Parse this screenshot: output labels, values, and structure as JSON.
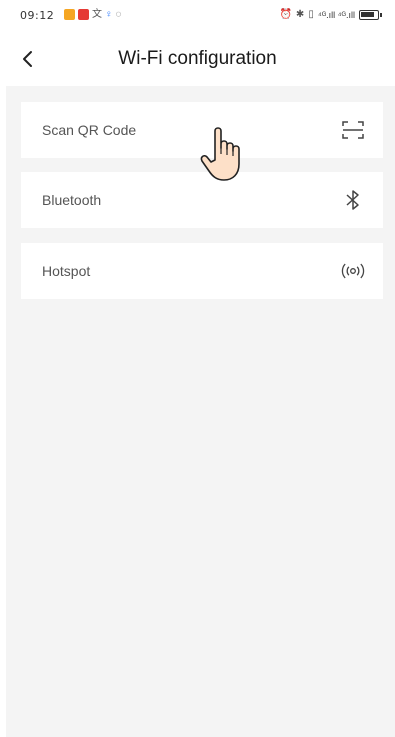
{
  "status_bar": {
    "time": "09:12",
    "right_text": "⁴ᴳ.ıll ⁴ᴳ.ıll"
  },
  "header": {
    "title": "Wi-Fi configuration",
    "back_icon": "chevron-left-icon"
  },
  "options": [
    {
      "label": "Scan QR Code",
      "icon": "qr-scan-icon"
    },
    {
      "label": "Bluetooth",
      "icon": "bluetooth-icon"
    },
    {
      "label": "Hotspot",
      "icon": "hotspot-icon"
    }
  ],
  "colors": {
    "background": "#f4f4f4",
    "card": "#ffffff",
    "text": "#555555",
    "title": "#1a1a1a"
  }
}
